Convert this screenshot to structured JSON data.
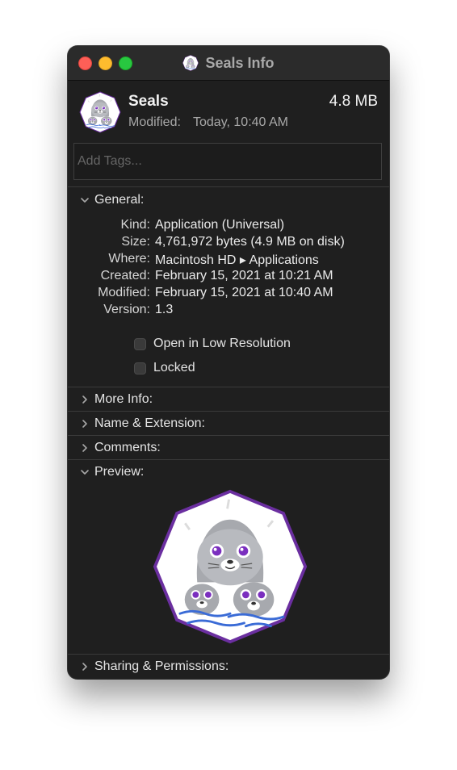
{
  "window": {
    "title": "Seals Info"
  },
  "header": {
    "name": "Seals",
    "size": "4.8 MB",
    "modified_label": "Modified:",
    "modified_value": "Today, 10:40 AM"
  },
  "tags": {
    "placeholder": "Add Tags..."
  },
  "sections": {
    "general": {
      "label": "General:",
      "expanded": true
    },
    "more_info": {
      "label": "More Info:",
      "expanded": false
    },
    "name_extension": {
      "label": "Name & Extension:",
      "expanded": false
    },
    "comments": {
      "label": "Comments:",
      "expanded": false
    },
    "preview": {
      "label": "Preview:",
      "expanded": true
    },
    "sharing": {
      "label": "Sharing & Permissions:",
      "expanded": false
    }
  },
  "general": {
    "rows": [
      {
        "key": "Kind:",
        "value": "Application (Universal)"
      },
      {
        "key": "Size:",
        "value": "4,761,972 bytes (4.9 MB on disk)"
      },
      {
        "key": "Where:",
        "value": "Macintosh HD ▸ Applications"
      },
      {
        "key": "Created:",
        "value": "February 15, 2021 at 10:21 AM"
      },
      {
        "key": "Modified:",
        "value": "February 15, 2021 at 10:40 AM"
      },
      {
        "key": "Version:",
        "value": "1.3"
      }
    ],
    "checkboxes": [
      {
        "label": "Open in Low Resolution",
        "checked": false
      },
      {
        "label": "Locked",
        "checked": false
      }
    ]
  },
  "icons": {
    "app": "seals-app-icon",
    "chevron_down": "chevron-down-icon",
    "chevron_right": "chevron-right-icon"
  },
  "colors": {
    "window_bg": "#1f1f1f",
    "titlebar_bg": "#2b2b2b",
    "close": "#fe5f57",
    "minimize": "#febc2e",
    "zoom": "#28c840",
    "badge_border": "#6b2fa0",
    "seal_gray": "#a7a9ae"
  }
}
